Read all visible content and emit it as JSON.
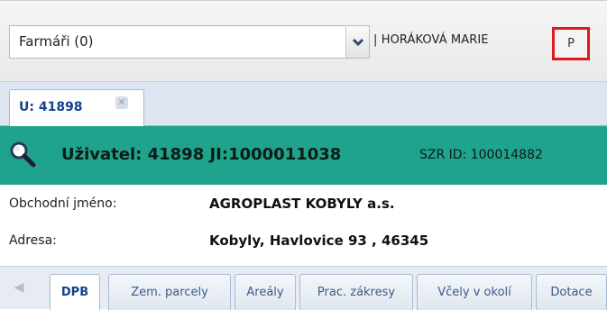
{
  "toolbar": {
    "combo_value": "Farmáři (0)",
    "user_label": "| HORÁKOVÁ MARIE",
    "p_button": "P"
  },
  "tabs": [
    {
      "label": "U: 41898",
      "close": "✕"
    }
  ],
  "header": {
    "title": "Uživatel: 41898  JI:1000011038",
    "szr": "SZR ID: 100014882"
  },
  "details": {
    "business_name_label": "Obchodní jméno:",
    "business_name_value": "AGROPLAST KOBYLY a.s.",
    "address_label": "Adresa:",
    "address_value": "Kobyly, Havlovice 93 , 46345"
  },
  "bottom_tabs": [
    "DPB",
    "Zem. parcely",
    "Areály",
    "Prac. zákresy",
    "Včely v okolí",
    "Dotace"
  ],
  "icons": {
    "combo_trigger": "chevron-down-icon",
    "header": "magnifier-icon",
    "scroll": "arrow-left-icon"
  },
  "colors": {
    "header_bg": "#1fa38c",
    "highlight": "#e0191e",
    "tab_text": "#15428b"
  }
}
